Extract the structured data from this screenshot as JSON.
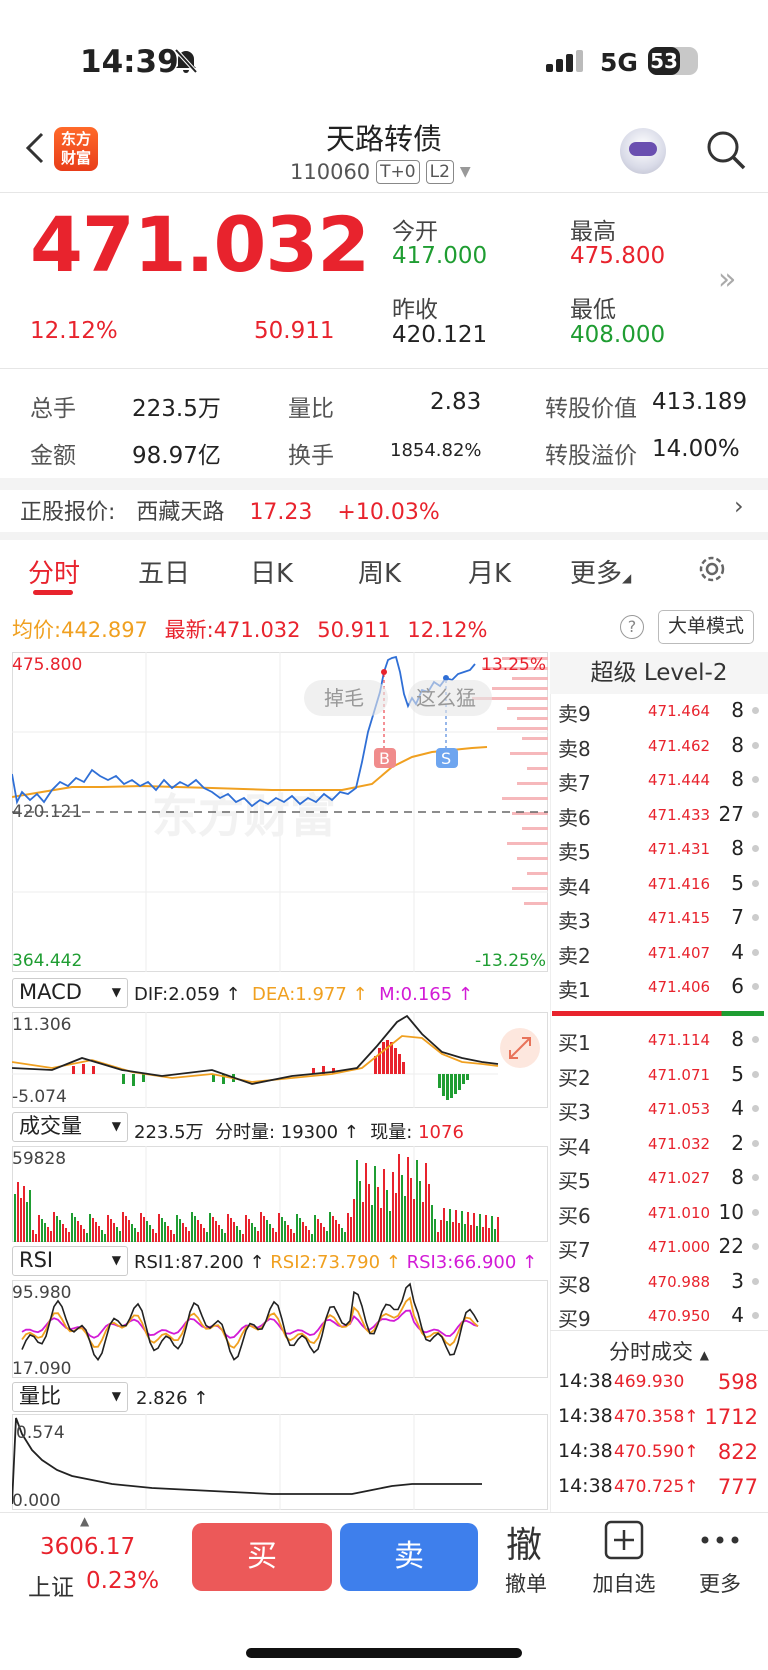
{
  "status": {
    "time": "14:39",
    "network": "5G",
    "battery": "53"
  },
  "header": {
    "title": "天路转债",
    "code": "110060",
    "tag1": "T+0",
    "tag2": "L2",
    "logo_line1": "东方",
    "logo_line2": "财富"
  },
  "quote": {
    "price": "471.032",
    "change_pct": "12.12%",
    "change_amt": "50.911",
    "open_label": "今开",
    "open": "417.000",
    "high_label": "最高",
    "high": "475.800",
    "prev_close_label": "昨收",
    "prev_close": "420.121",
    "low_label": "最低",
    "low": "408.000"
  },
  "stats": {
    "vol_label": "总手",
    "vol": "223.5万",
    "vr_label": "量比",
    "vr": "2.83",
    "conv_val_label": "转股价值",
    "conv_val": "413.189",
    "amount_label": "金额",
    "amount": "98.97亿",
    "turnover_label": "换手",
    "turnover": "1854.82%",
    "premium_label": "转股溢价",
    "premium": "14.00%"
  },
  "stock": {
    "label": "正股报价:",
    "name": "西藏天路",
    "price": "17.23",
    "change": "+10.03%"
  },
  "tabs": [
    "分时",
    "五日",
    "日K",
    "周K",
    "月K",
    "更多"
  ],
  "info": {
    "avg_label": "均价:",
    "avg": "442.897",
    "latest_label": "最新:",
    "latest": "471.032",
    "chg": "50.911",
    "pct": "12.12%",
    "big_order": "大单模式"
  },
  "chart_meta": {
    "top": "475.800",
    "mid": "420.121",
    "bottom": "364.442",
    "top_pct": "13.25%",
    "bottom_pct": "-13.25%",
    "bubble1": "掉毛",
    "bubble2": "这么猛",
    "mark_b": "B",
    "mark_s": "S",
    "watermark": "东方财富"
  },
  "macd": {
    "name": "MACD",
    "dif": "DIF:2.059 ↑",
    "dea": "DEA:1.977 ↑",
    "m": "M:0.165 ↑",
    "max": "11.306",
    "min": "-5.074"
  },
  "volume": {
    "name": "成交量",
    "total": "223.5万",
    "minute": "分时量: 19300 ↑",
    "now_label": "现量:",
    "now": "1076",
    "max": "59828"
  },
  "rsi": {
    "name": "RSI",
    "rsi1": "RSI1:87.200 ↑",
    "rsi2": "RSI2:73.790 ↑",
    "rsi3": "RSI3:66.900 ↑",
    "max": "95.980",
    "min": "17.090"
  },
  "vr_ind": {
    "name": "量比",
    "value": "2.826 ↑",
    "max": "0.574",
    "min": "0.000"
  },
  "orderbook": {
    "title": "超级 Level-2",
    "asks": [
      {
        "label": "卖9",
        "price": "471.464",
        "vol": "8"
      },
      {
        "label": "卖8",
        "price": "471.462",
        "vol": "8"
      },
      {
        "label": "卖7",
        "price": "471.444",
        "vol": "8"
      },
      {
        "label": "卖6",
        "price": "471.433",
        "vol": "27"
      },
      {
        "label": "卖5",
        "price": "471.431",
        "vol": "8"
      },
      {
        "label": "卖4",
        "price": "471.416",
        "vol": "5"
      },
      {
        "label": "卖3",
        "price": "471.415",
        "vol": "7"
      },
      {
        "label": "卖2",
        "price": "471.407",
        "vol": "4"
      },
      {
        "label": "卖1",
        "price": "471.406",
        "vol": "6"
      }
    ],
    "bids": [
      {
        "label": "买1",
        "price": "471.114",
        "vol": "8"
      },
      {
        "label": "买2",
        "price": "471.071",
        "vol": "5"
      },
      {
        "label": "买3",
        "price": "471.053",
        "vol": "4"
      },
      {
        "label": "买4",
        "price": "471.032",
        "vol": "2"
      },
      {
        "label": "买5",
        "price": "471.027",
        "vol": "8"
      },
      {
        "label": "买6",
        "price": "471.010",
        "vol": "10"
      },
      {
        "label": "买7",
        "price": "471.000",
        "vol": "22"
      },
      {
        "label": "买8",
        "price": "470.988",
        "vol": "3"
      },
      {
        "label": "买9",
        "price": "470.950",
        "vol": "4"
      }
    ]
  },
  "trades": {
    "title": "分时成交",
    "rows": [
      {
        "time": "14:38",
        "price": "469.930",
        "vol": "598"
      },
      {
        "time": "14:38",
        "price": "470.358↑",
        "vol": "1712"
      },
      {
        "time": "14:38",
        "price": "470.590↑",
        "vol": "822"
      },
      {
        "time": "14:38",
        "price": "470.725↑",
        "vol": "777"
      }
    ]
  },
  "bottom": {
    "index_value": "3606.17",
    "index_name": "上证",
    "index_pct": "0.23%",
    "buy": "买",
    "sell": "卖",
    "cancel_icon": "撤",
    "cancel": "撤单",
    "watch": "加自选",
    "more": "更多"
  },
  "colors": {
    "up": "#e8232d",
    "down": "#1f9d32",
    "avg": "#f0a020",
    "line": "#2f6fd6"
  }
}
